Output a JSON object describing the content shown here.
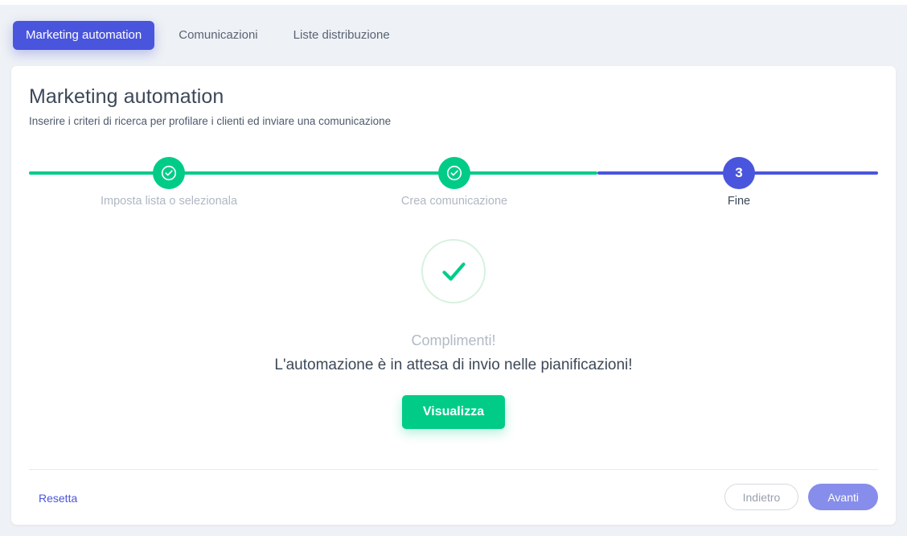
{
  "tabs": [
    {
      "label": "Marketing automation",
      "active": true
    },
    {
      "label": "Comunicazioni",
      "active": false
    },
    {
      "label": "Liste distribuzione",
      "active": false
    }
  ],
  "card": {
    "title": "Marketing automation",
    "subtitle": "Inserire i criteri di ricerca per profilare i clienti ed inviare una comunicazione"
  },
  "stepper": {
    "steps": [
      {
        "label": "Imposta lista o selezionala",
        "state": "done",
        "marker": "check-circle-icon"
      },
      {
        "label": "Crea comunicazione",
        "state": "done",
        "marker": "check-circle-icon"
      },
      {
        "label": "Fine",
        "state": "current",
        "marker": "3"
      }
    ],
    "colors": {
      "done": "#00cc88",
      "current": "#4a55dd"
    }
  },
  "success": {
    "icon": "check-circle-success-icon",
    "congrats": "Complimenti!",
    "message": "L'automazione è in attesa di invio nelle pianificazioni!",
    "action_label": "Visualizza",
    "action_color": "#00cc88"
  },
  "footer": {
    "reset_label": "Resetta",
    "back_label": "Indietro",
    "next_label": "Avanti",
    "next_color": "#868dea",
    "link_color": "#4a55dd"
  }
}
